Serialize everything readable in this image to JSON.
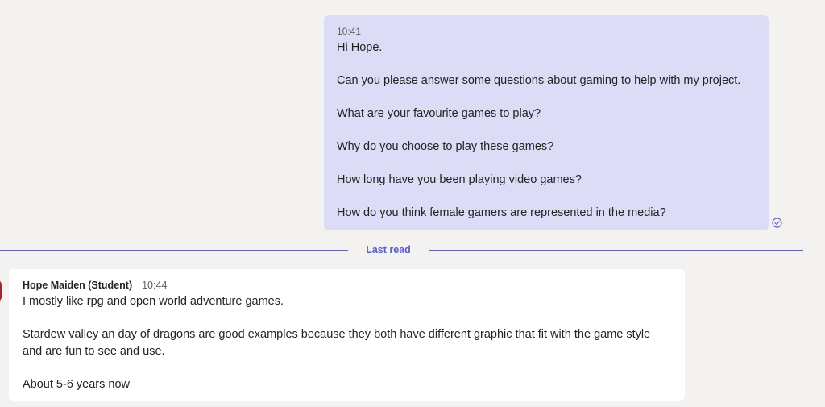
{
  "sent_message": {
    "time": "10:41",
    "lines": [
      "Hi Hope.",
      "Can you please answer some questions about gaming to help with my project.",
      "What are your favourite games to play?",
      "Why do you choose to play these games?",
      "How long have you been playing video games?",
      "How do you think female gamers are represented in the media?"
    ],
    "status_icon": "read-receipt-icon",
    "bubble_color": "#dcdcf6"
  },
  "divider": {
    "label": "Last read",
    "color": "#5b5fc7"
  },
  "received_message": {
    "sender": "Hope Maiden (Student)",
    "time": "10:44",
    "paragraphs": [
      "I mostly like rpg and open world adventure games.",
      "Stardew valley an day of dragons are good examples because they both have different graphic that fit with the game style and are fun to see and use.",
      "About 5-6 years now"
    ],
    "bubble_color": "#ffffff"
  },
  "colors": {
    "background": "#f3f2f1",
    "accent": "#6264a7"
  }
}
